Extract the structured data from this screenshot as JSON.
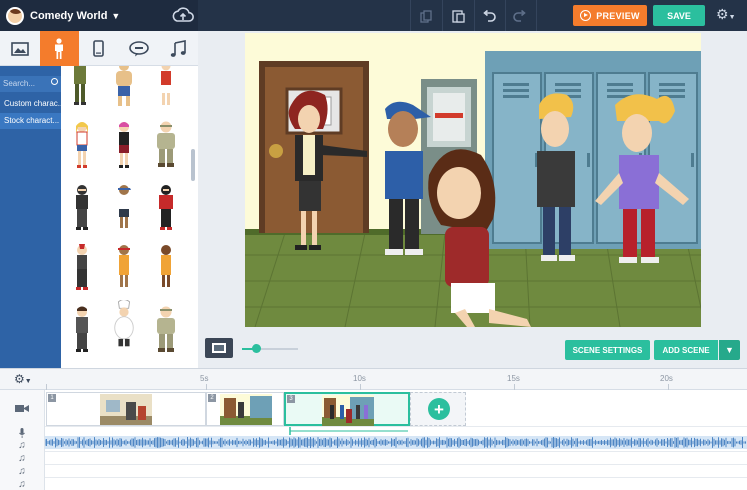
{
  "topbar": {
    "project_title": "Comedy World",
    "preview_label": "PREVIEW",
    "save_label": "SAVE"
  },
  "left_panel": {
    "tabs": [
      "background",
      "character",
      "prop",
      "bubble",
      "music"
    ],
    "search_placeholder": "Search...",
    "categories": [
      "Custom charac...",
      "Stock charact..."
    ]
  },
  "stage": {
    "scene_settings_label": "SCENE SETTINGS",
    "add_scene_label": "ADD SCENE"
  },
  "timeline": {
    "ticks": [
      "5s",
      "10s",
      "15s",
      "20s"
    ],
    "scenes": [
      {
        "number": "1"
      },
      {
        "number": "2"
      },
      {
        "number": "3"
      }
    ],
    "track_icons": [
      "camera-icon",
      "microphone-icon",
      "music-note-icon",
      "music-note-icon",
      "music-note-icon",
      "music-note-icon"
    ]
  },
  "colors": {
    "accent": "#2bbf9e",
    "preview": "#f47c2c",
    "topbar": "#243348",
    "sidebar": "#2e63a6"
  }
}
